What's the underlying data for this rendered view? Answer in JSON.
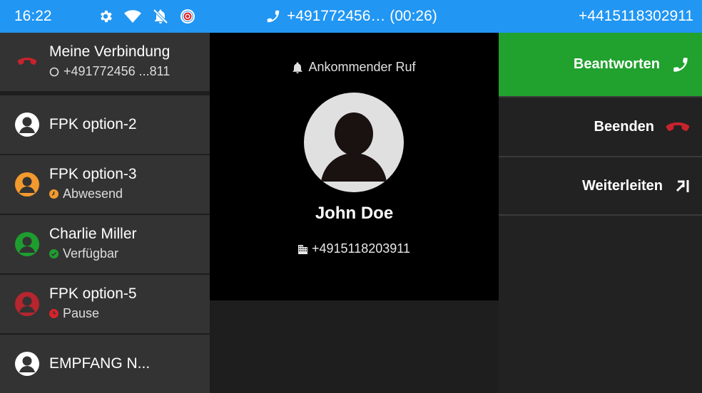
{
  "statusbar": {
    "time": "16:22",
    "icons": [
      "gear-icon",
      "wifi-icon",
      "bell-off-icon",
      "record-icon"
    ],
    "call_info": "+491772456… (00:26)",
    "own_number": "+4415118302911",
    "color": "#2196f3"
  },
  "lines": [
    {
      "name": "Meine Verbindung",
      "sub": "+491772456 ...811",
      "icon": "hangup-icon"
    },
    {
      "name": "FPK option-2",
      "icon": "avatar-white"
    },
    {
      "name": "FPK option-3",
      "sub": "Abwesend",
      "status_color": "#f29a2e",
      "icon": "avatar-orange"
    },
    {
      "name": "Charlie Miller",
      "sub": "Verfügbar",
      "status_color": "#1e9d2f",
      "icon": "avatar-green"
    },
    {
      "name": "FPK option-5",
      "sub": "Pause",
      "status_color": "#b7252f",
      "icon": "avatar-red"
    },
    {
      "name": "EMPFANG N...",
      "icon": "avatar-white"
    }
  ],
  "call": {
    "state": "Ankommender Ruf",
    "caller_name": "John Doe",
    "caller_number": "+4915118203911"
  },
  "actions": {
    "answer": "Beantworten",
    "end": "Beenden",
    "forward": "Weiterleiten",
    "answer_color": "#21a12e",
    "end_color": "#c8232c"
  }
}
